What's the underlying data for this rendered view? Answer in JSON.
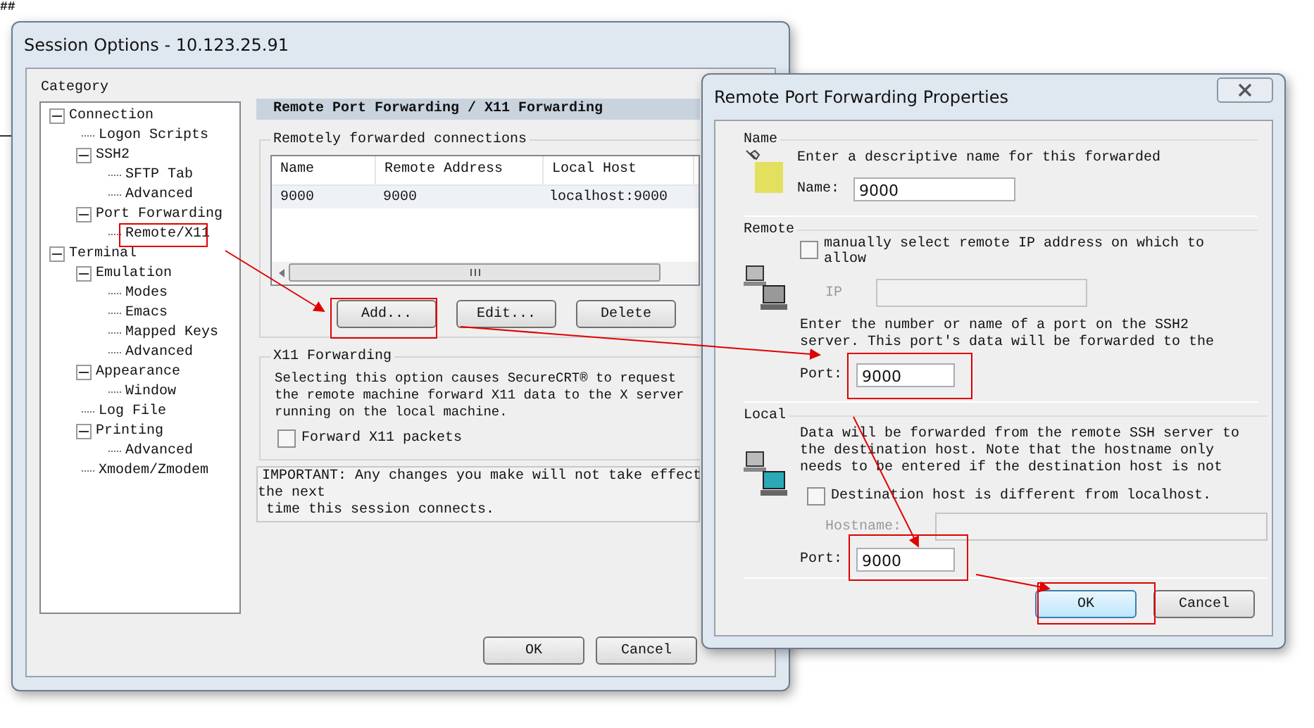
{
  "stray_text": "##",
  "session_window": {
    "title": "Session Options - 10.123.25.91",
    "category_label": "Category",
    "category_tree": [
      {
        "label": "Connection",
        "expanded": true,
        "children": [
          {
            "label": "Logon Scripts"
          },
          {
            "label": "SSH2",
            "expanded": true,
            "children": [
              {
                "label": "SFTP Tab"
              },
              {
                "label": "Advanced"
              }
            ]
          },
          {
            "label": "Port Forwarding",
            "expanded": true,
            "children": [
              {
                "label": "Remote/X11"
              }
            ]
          }
        ]
      },
      {
        "label": "Terminal",
        "expanded": true,
        "children": [
          {
            "label": "Emulation",
            "expanded": true,
            "children": [
              {
                "label": "Modes"
              },
              {
                "label": "Emacs"
              },
              {
                "label": "Mapped Keys"
              },
              {
                "label": "Advanced"
              }
            ]
          },
          {
            "label": "Appearance",
            "expanded": true,
            "children": [
              {
                "label": "Window"
              }
            ]
          },
          {
            "label": "Log File"
          },
          {
            "label": "Printing",
            "expanded": true,
            "children": [
              {
                "label": "Advanced"
              }
            ]
          },
          {
            "label": "Xmodem/Zmodem"
          }
        ]
      }
    ],
    "panel_header": "Remote Port Forwarding / X11 Forwarding",
    "forwarded_group": {
      "title": "Remotely forwarded connections",
      "columns": [
        "Name",
        "Remote Address",
        "Local Host"
      ],
      "rows": [
        [
          "9000",
          "9000",
          "localhost:9000"
        ]
      ],
      "buttons": [
        "Add...",
        "Edit...",
        "Delete"
      ]
    },
    "x11_group": {
      "title": "X11 Forwarding",
      "description_lines": [
        "Selecting this option causes SecureCRT® to request",
        "the remote machine forward X11 data to the X server",
        "running on the local machine."
      ],
      "checkbox": {
        "label": "Forward X11 packets",
        "checked": false
      }
    },
    "notice_lines": [
      "IMPORTANT: Any changes you make will not take effect",
      "the next",
      " time this session connects."
    ],
    "buttons": [
      "OK",
      "Cancel"
    ]
  },
  "properties_dialog": {
    "title": "Remote Port Forwarding Properties",
    "name_section": {
      "title": "Name",
      "description": "Enter a descriptive name for this forwarded",
      "field_label": "Name:",
      "value": "9000"
    },
    "remote_section": {
      "title": "Remote",
      "checkbox": {
        "label_lines": [
          "manually select remote IP address on which to",
          "allow"
        ],
        "checked": false
      },
      "ip_label": "IP",
      "description_lines": [
        "Enter the number or name of a port on the SSH2",
        "server.  This port's data will be forwarded to the"
      ],
      "port_label": "Port:",
      "port_value": "9000"
    },
    "local_section": {
      "title": "Local",
      "description_lines": [
        "Data will be forwarded from the remote SSH server to",
        "the destination host.  Note that the hostname only",
        "needs to be entered if the destination host is not"
      ],
      "checkbox": {
        "label": "Destination host is different from localhost.",
        "checked": false
      },
      "hostname_label": "Hostname:",
      "port_label": "Port:",
      "port_value": "9000"
    },
    "buttons": [
      "OK",
      "Cancel"
    ]
  }
}
